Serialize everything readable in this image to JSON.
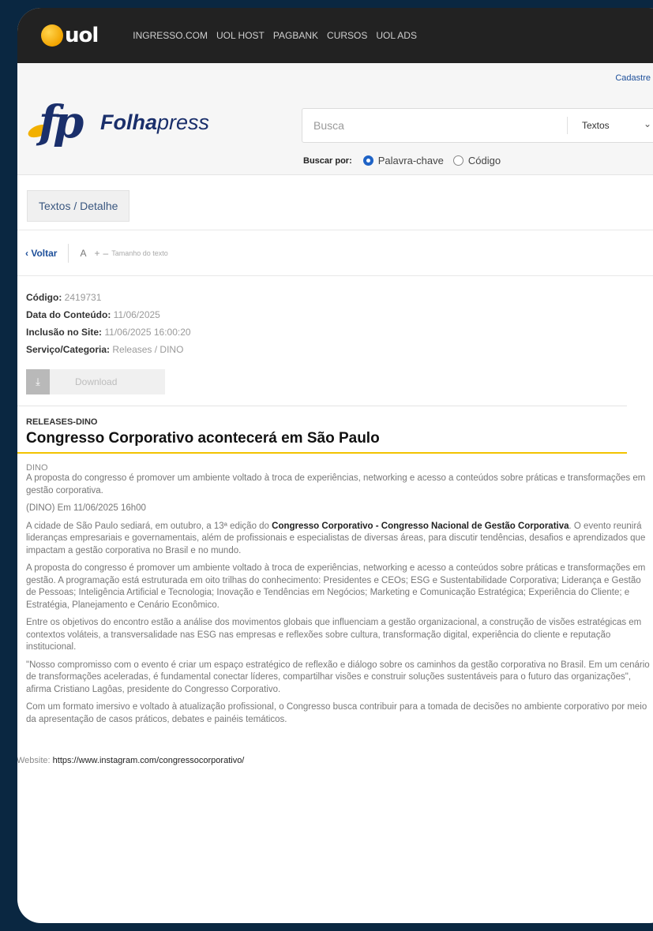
{
  "brand": {
    "uol_logo": "uol",
    "folhapress_bold": "Folha",
    "folhapress_light": "press",
    "folhapress_mark": "fp"
  },
  "topnav": [
    "INGRESSO.COM",
    "UOL HOST",
    "PAGBANK",
    "CURSOS",
    "UOL ADS"
  ],
  "header": {
    "signup": "Cadastre",
    "search_placeholder": "Busca",
    "search_type": "Textos",
    "search_by_label": "Buscar por:",
    "options": [
      "Palavra-chave",
      "Código"
    ],
    "selected_option": "Palavra-chave"
  },
  "breadcrumb": "Textos / Detalhe",
  "toolbar": {
    "back": "Voltar",
    "font_icon": "A",
    "increase": "+",
    "decrease": "–",
    "font_label": "Tamanho do texto"
  },
  "meta": {
    "code_label": "Código:",
    "code": "2419731",
    "date_label": "Data do Conteúdo:",
    "date": "11/06/2025",
    "inclusion_label": "Inclusão no Site:",
    "inclusion": "11/06/2025 16:00:20",
    "category_label": "Serviço/Categoria:",
    "category": "Releases / DINO",
    "download_label": "Download",
    "download_icon": "download-arrow-icon"
  },
  "article": {
    "kicker": "RELEASES-DINO",
    "headline": "Congresso Corporativo acontecerá em São Paulo",
    "source": "DINO",
    "lead": "A proposta do congresso é promover um ambiente voltado à troca de experiências, networking e acesso a conteúdos sobre práticas e transformações em gestão corporativa.",
    "dateline": "(DINO) Em 11/06/2025 16h00",
    "p1_a": "A cidade de São Paulo sediará, em outubro, a 13ª edição do ",
    "p1_bold": "Congresso Corporativo - Congresso Nacional de Gestão Corporativa",
    "p1_b": ". O evento reunirá lideranças empresariais e governamentais, além de profissionais e especialistas de diversas áreas, para discutir tendências, desafios e aprendizados que impactam a gestão corporativa no Brasil e no mundo.",
    "p2": "A proposta do congresso é promover um ambiente voltado à troca de experiências, networking e acesso a conteúdos sobre práticas e transformações em gestão. A programação está estruturada em oito trilhas do conhecimento: Presidentes e CEOs; ESG e Sustentabilidade Corporativa; Liderança e Gestão de Pessoas; Inteligência Artificial e Tecnologia; Inovação e Tendências em Negócios; Marketing e Comunicação Estratégica; Experiência do Cliente; e Estratégia, Planejamento e Cenário Econômico.",
    "p3": "Entre os objetivos do encontro estão a análise dos movimentos globais que influenciam a gestão organizacional, a construção de visões estratégicas em contextos voláteis, a transversalidade nas ESG nas empresas e reflexões sobre cultura, transformação digital, experiência do cliente e reputação institucional.",
    "p4": "\"Nosso compromisso com o evento é criar um espaço estratégico de reflexão e diálogo sobre os caminhos da gestão corporativa no Brasil. Em um cenário de transformações aceleradas, é fundamental conectar líderes, compartilhar visões e construir soluções sustentáveis para o futuro das organizações\", afirma Cristiano Lagôas, presidente do Congresso Corporativo.",
    "p5": "Com um formato imersivo e voltado à atualização profissional, o Congresso busca contribuir para a tomada de decisões no ambiente corporativo por meio da apresentação de casos práticos, debates e painéis temáticos.",
    "website_label": "Website: ",
    "website_url": "https://www.instagram.com/congressocorporativo/"
  }
}
